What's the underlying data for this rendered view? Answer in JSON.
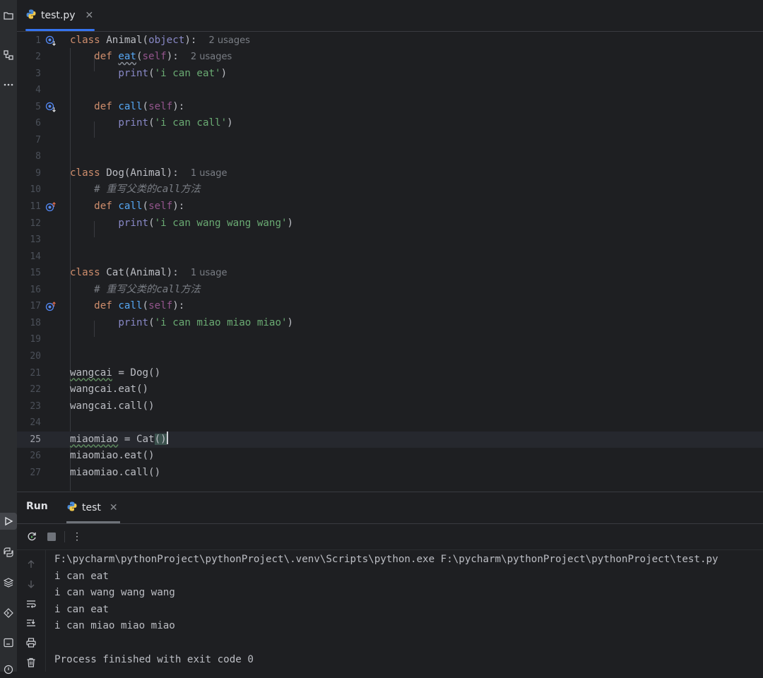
{
  "editor_tab": {
    "label": "test.py",
    "close": "✕"
  },
  "code_lines": [
    {
      "n": "1",
      "html": "<span class=\"kw\">class</span> Animal(<span class=\"builtin\">object</span>):  <span class=\"hint\">2 usages</span>"
    },
    {
      "n": "2",
      "html": "    <span class=\"kw\">def</span> <span class=\"fn squig-eat\">eat</span>(<span class=\"self\">self</span>):  <span class=\"hint\">2 usages</span>"
    },
    {
      "n": "3",
      "html": "        <span class=\"builtin\">print</span>(<span class=\"str\">'i can eat'</span>)"
    },
    {
      "n": "4",
      "html": ""
    },
    {
      "n": "5",
      "html": "    <span class=\"kw\">def</span> <span class=\"fn\">call</span>(<span class=\"self\">self</span>):"
    },
    {
      "n": "6",
      "html": "        <span class=\"builtin\">print</span>(<span class=\"str\">'i can call'</span>)"
    },
    {
      "n": "7",
      "html": ""
    },
    {
      "n": "8",
      "html": ""
    },
    {
      "n": "9",
      "html": "<span class=\"kw\">class</span> Dog(Animal):  <span class=\"hint\">1 usage</span>"
    },
    {
      "n": "10",
      "html": "    <span class=\"cmt\"># 重写父类的call方法</span>"
    },
    {
      "n": "11",
      "html": "    <span class=\"kw\">def</span> <span class=\"fn\">call</span>(<span class=\"self\">self</span>):"
    },
    {
      "n": "12",
      "html": "        <span class=\"builtin\">print</span>(<span class=\"str\">'i can wang wang wang'</span>)"
    },
    {
      "n": "13",
      "html": ""
    },
    {
      "n": "14",
      "html": ""
    },
    {
      "n": "15",
      "html": "<span class=\"kw\">class</span> Cat(Animal):  <span class=\"hint\">1 usage</span>"
    },
    {
      "n": "16",
      "html": "    <span class=\"cmt\"># 重写父类的call方法</span>"
    },
    {
      "n": "17",
      "html": "    <span class=\"kw\">def</span> <span class=\"fn\">call</span>(<span class=\"self\">self</span>):"
    },
    {
      "n": "18",
      "html": "        <span class=\"builtin\">print</span>(<span class=\"str\">'i can miao miao miao'</span>)"
    },
    {
      "n": "19",
      "html": ""
    },
    {
      "n": "20",
      "html": ""
    },
    {
      "n": "21",
      "html": "<span class=\"squig\">wangcai</span> = Dog()"
    },
    {
      "n": "22",
      "html": "wangcai.eat()"
    },
    {
      "n": "23",
      "html": "wangcai.call()"
    },
    {
      "n": "24",
      "html": ""
    },
    {
      "n": "25",
      "html": "<span class=\"squig\">miaomiao</span> = Cat<span class=\"bracket\">(</span><span class=\"bracket\">)</span><span class=\"caret\"></span>"
    },
    {
      "n": "26",
      "html": "miaomiao.eat()"
    },
    {
      "n": "27",
      "html": "miaomiao.call()"
    }
  ],
  "gutter_icons": [
    {
      "line": 1,
      "kind": "overridden"
    },
    {
      "line": 5,
      "kind": "overridden"
    },
    {
      "line": 11,
      "kind": "overrides"
    },
    {
      "line": 17,
      "kind": "overrides"
    }
  ],
  "current_line": 25,
  "run_panel": {
    "title": "Run",
    "tab_label": "test",
    "tab_close": "✕",
    "more": "⋮",
    "console": [
      "F:\\pycharm\\pythonProject\\pythonProject\\.venv\\Scripts\\python.exe F:\\pycharm\\pythonProject\\pythonProject\\test.py",
      "i can eat",
      "i can wang wang wang",
      "i can eat",
      "i can miao miao miao",
      "",
      "Process finished with exit code 0"
    ]
  },
  "colors": {
    "background": "#1e1f22",
    "keyword": "#cf8e6d",
    "function": "#56a8f5",
    "string": "#6aab73",
    "self": "#94558d",
    "builtin": "#8888c6",
    "comment": "#7a7e85",
    "accent": "#3574f0"
  }
}
